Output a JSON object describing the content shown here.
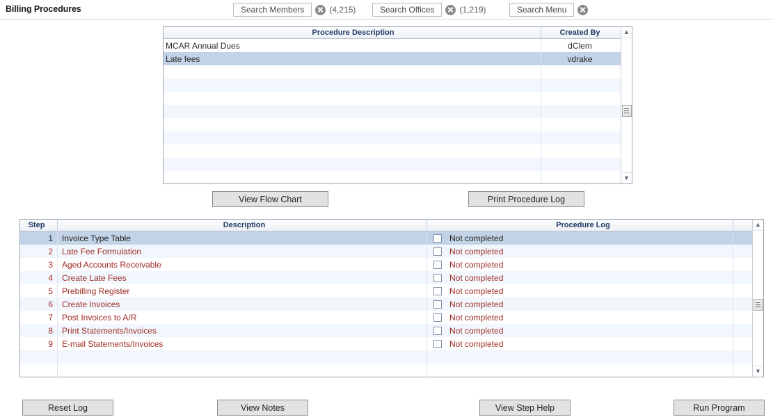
{
  "header": {
    "title": "Billing Procedures",
    "search_widgets": [
      {
        "label": "Search Members",
        "clear_icon": "close-circle-icon",
        "count": "(4,215)"
      },
      {
        "label": "Search Offices",
        "clear_icon": "close-circle-icon",
        "count": "(1,219)"
      },
      {
        "label": "Search Menu",
        "clear_icon": "close-circle-icon",
        "count": ""
      }
    ]
  },
  "procedures_grid": {
    "columns": [
      "Procedure Description",
      "Created By"
    ],
    "rows": [
      {
        "description": "MCAR Annual Dues",
        "created_by": "dClem",
        "selected": false
      },
      {
        "description": "Late fees",
        "created_by": "vdrake",
        "selected": true
      }
    ],
    "empty_row_count": 9,
    "scrollbar": {
      "up_icon": "chevron-up-icon",
      "down_icon": "chevron-down-icon"
    }
  },
  "mid_buttons": {
    "view_flow_chart": "View Flow Chart",
    "print_procedure_log": "Print Procedure Log"
  },
  "steps_grid": {
    "columns": [
      "Step",
      "Description",
      "Procedure Log"
    ],
    "rows": [
      {
        "step": "1",
        "description": "Invoice Type Table",
        "log": "Not completed",
        "checked": false,
        "selected": true
      },
      {
        "step": "2",
        "description": "Late Fee Formulation",
        "log": "Not completed",
        "checked": false,
        "selected": false
      },
      {
        "step": "3",
        "description": "Aged Accounts Receivable",
        "log": "Not completed",
        "checked": false,
        "selected": false
      },
      {
        "step": "4",
        "description": "Create Late Fees",
        "log": "Not completed",
        "checked": false,
        "selected": false
      },
      {
        "step": "5",
        "description": "Prebilling Register",
        "log": "Not completed",
        "checked": false,
        "selected": false
      },
      {
        "step": "6",
        "description": "Create Invoices",
        "log": "Not completed",
        "checked": false,
        "selected": false
      },
      {
        "step": "7",
        "description": "Post Invoices to A/R",
        "log": "Not completed",
        "checked": false,
        "selected": false
      },
      {
        "step": "8",
        "description": "Print Statements/Invoices",
        "log": "Not completed",
        "checked": false,
        "selected": false
      },
      {
        "step": "9",
        "description": "E-mail Statements/Invoices",
        "log": "Not completed",
        "checked": false,
        "selected": false
      }
    ],
    "empty_row_count": 2,
    "scrollbar": {
      "up_icon": "chevron-up-icon",
      "down_icon": "chevron-down-icon"
    }
  },
  "bottom_buttons": {
    "reset_log": "Reset Log",
    "view_notes": "View Notes",
    "view_step_help": "View Step Help",
    "run_program": "Run Program"
  },
  "colors": {
    "selected_row": "#c3d3e7",
    "alt_row": "#f2f7fd",
    "header_text": "#1f3864",
    "step_text": "#9e2b25"
  }
}
